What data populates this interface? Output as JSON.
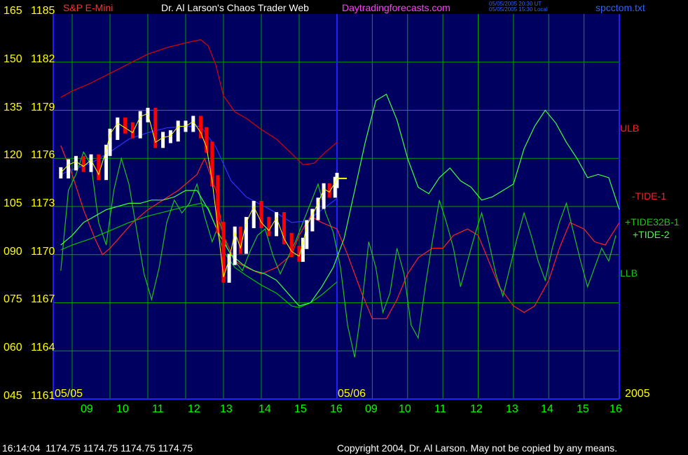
{
  "header": {
    "symbol": "S&P E-Mini",
    "title": "Dr. Al Larson's Chaos Trader Web",
    "site": "Daytradingforecasts.com",
    "time_ut": "05/05/2005 20:30 UT",
    "time_local": "05/05/2005 15:30 Local",
    "file": "spcctom.txt"
  },
  "footer": {
    "clock": "16:14:04",
    "ohlc": "1174.75 1174.75 1174.75 1174.75",
    "copyright": "Copyright 2004, Dr. Al Larson. May not be copied by any means."
  },
  "colors": {
    "background": "#000060",
    "grid": "#00a000",
    "axis": "#2020ff",
    "left_labels": "#ffff00",
    "time_labels": "#00ff00",
    "price_up": "#ffffff",
    "price_down": "#ff0000",
    "ulb": "#e00000",
    "llb": "#00c000",
    "tide_1": "#ff2020",
    "tide32b": "#20c020",
    "tide_2": "#40ff40",
    "blue_avg": "#3030ff",
    "yellow_avg": "#ffff00"
  },
  "chart_data": {
    "type": "line",
    "title": "S&P E-Mini",
    "y_left_osc": [
      "165",
      "150",
      "135",
      "120",
      "105",
      "090",
      "075",
      "060",
      "045"
    ],
    "y_left_price": [
      "1185",
      "1182",
      "1179",
      "1176",
      "1173",
      "1170",
      "1167",
      "1164",
      "1161"
    ],
    "ylim_price": [
      1161,
      1185
    ],
    "ylim_osc": [
      45,
      165
    ],
    "date_labels": [
      "05/05",
      "05/06"
    ],
    "year_label": "2005",
    "x_ticks": [
      "09",
      "10",
      "11",
      "12",
      "13",
      "14",
      "15",
      "16",
      "09",
      "10",
      "11",
      "12",
      "13",
      "14",
      "15",
      "16"
    ],
    "grid": true,
    "legend": [
      "ULB",
      "-TIDE-1",
      "+TIDE32B-1",
      "+TIDE-2",
      "LLB"
    ],
    "series": [
      {
        "name": "S&P E-Mini",
        "x": [
          8.7,
          8.9,
          9.1,
          9.3,
          9.5,
          9.7,
          9.9,
          10.0,
          10.2,
          10.4,
          10.6,
          10.8,
          11.0,
          11.2,
          11.4,
          11.6,
          11.8,
          12.0,
          12.2,
          12.4,
          12.55,
          12.7,
          12.85,
          13.0,
          13.15,
          13.3,
          13.45,
          13.6,
          13.8,
          14.0,
          14.2,
          14.4,
          14.6,
          14.8,
          15.0,
          15.1,
          15.2,
          15.35,
          15.5,
          15.65,
          15.8,
          15.95,
          16.0
        ],
        "values": [
          1175.1,
          1175.6,
          1175.8,
          1175.5,
          1175.9,
          1175.0,
          1176.5,
          1177.5,
          1178.2,
          1177.9,
          1177.6,
          1178.6,
          1178.8,
          1177.0,
          1177.3,
          1177.4,
          1178.0,
          1178.0,
          1178.3,
          1177.6,
          1176.7,
          1174.6,
          1171.7,
          1168.6,
          1169.7,
          1171.4,
          1170.4,
          1172.0,
          1173.0,
          1172.0,
          1171.5,
          1172.3,
          1171.0,
          1170.2,
          1169.9,
          1170.7,
          1171.8,
          1172.5,
          1173.2,
          1174.1,
          1173.9,
          1174.5,
          1174.75
        ]
      },
      {
        "name": "ULB",
        "x": [
          8.7,
          9.0,
          9.5,
          10.0,
          10.5,
          11.0,
          11.5,
          12.0,
          12.4,
          12.6,
          12.8,
          13.0,
          13.3,
          13.6,
          14.0,
          14.4,
          14.8,
          15.1,
          15.4,
          15.7,
          16.0
        ],
        "values": [
          1179.8,
          1180.2,
          1180.7,
          1181.3,
          1181.9,
          1182.5,
          1182.9,
          1183.2,
          1183.4,
          1183.0,
          1181.8,
          1179.9,
          1178.9,
          1178.5,
          1177.8,
          1177.2,
          1176.3,
          1175.6,
          1175.7,
          1176.4,
          1177.0
        ]
      },
      {
        "name": "LLB",
        "x": [
          8.7,
          9.0,
          9.5,
          10.0,
          10.5,
          11.0,
          11.5,
          12.0,
          12.4,
          12.6,
          12.8,
          13.0,
          13.3,
          13.6,
          14.0,
          14.4,
          14.8,
          15.0,
          15.3,
          15.6,
          16.0
        ],
        "values": [
          1170.3,
          1170.6,
          1171.0,
          1171.5,
          1172.0,
          1172.4,
          1172.7,
          1173.0,
          1173.2,
          1172.9,
          1171.7,
          1170.2,
          1169.2,
          1168.7,
          1168.1,
          1167.6,
          1166.8,
          1166.7,
          1167.0,
          1167.5,
          1168.3
        ]
      },
      {
        "name": "-TIDE-1",
        "x": [
          8.7,
          9.0,
          9.3,
          9.6,
          9.8,
          10.0,
          10.3,
          10.6,
          11.0,
          11.4,
          11.8,
          12.0,
          12.3,
          12.5,
          12.8,
          13.0,
          13.3,
          13.6,
          14.0,
          14.4,
          14.8,
          15.0,
          15.3,
          15.6,
          16.0,
          16.3,
          16.7,
          17.0,
          17.4,
          17.7,
          18.0,
          18.3,
          18.7,
          19.0,
          19.3,
          19.7,
          20.0,
          20.3,
          20.6,
          21.0,
          21.3,
          21.6,
          22.0,
          22.3,
          22.6,
          23.0,
          23.3,
          23.6,
          24.0
        ],
        "values": [
          124,
          115,
          104,
          95,
          90,
          92,
          96,
          100,
          104,
          107,
          110,
          112,
          115,
          120,
          110,
          96,
          88,
          86,
          84,
          86,
          90,
          96,
          102,
          100,
          98,
          90,
          78,
          70,
          70,
          76,
          84,
          89,
          92,
          92,
          96,
          98,
          96,
          88,
          80,
          74,
          72,
          74,
          82,
          92,
          100,
          98,
          94,
          93,
          100
        ]
      },
      {
        "name": "+TIDE32B-1",
        "x": [
          8.7,
          8.9,
          9.1,
          9.3,
          9.5,
          9.7,
          9.9,
          10.1,
          10.3,
          10.5,
          10.7,
          10.9,
          11.1,
          11.3,
          11.5,
          11.7,
          11.9,
          12.1,
          12.3,
          12.5,
          12.7,
          12.9,
          13.1,
          13.3,
          13.5,
          13.7,
          13.9,
          14.1,
          14.3,
          14.5,
          14.7,
          14.9,
          15.1,
          15.3,
          15.5,
          15.7,
          15.9,
          16.1,
          16.3,
          16.5,
          16.7,
          16.9,
          17.1,
          17.3,
          17.5,
          17.7,
          17.9,
          18.1,
          18.3,
          18.5,
          18.7,
          18.9,
          19.1,
          19.3,
          19.5,
          19.7,
          19.9,
          20.1,
          20.3,
          20.5,
          20.7,
          20.9,
          21.1,
          21.3,
          21.5,
          21.7,
          21.9,
          22.1,
          22.3,
          22.5,
          22.7,
          22.9,
          23.1,
          23.3,
          23.5,
          23.7,
          23.9
        ],
        "values": [
          85,
          110,
          115,
          122,
          118,
          100,
          93,
          110,
          120,
          112,
          98,
          84,
          76,
          86,
          100,
          107,
          103,
          106,
          112,
          102,
          94,
          100,
          92,
          88,
          85,
          91,
          96,
          98,
          90,
          84,
          89,
          94,
          100,
          106,
          112,
          103,
          97,
          86,
          68,
          58,
          74,
          94,
          86,
          72,
          78,
          92,
          84,
          68,
          64,
          80,
          94,
          107,
          100,
          92,
          80,
          88,
          96,
          103,
          94,
          84,
          77,
          86,
          95,
          103,
          96,
          88,
          82,
          92,
          100,
          106,
          97,
          88,
          80,
          86,
          92,
          88,
          96
        ]
      },
      {
        "name": "+TIDE-2",
        "x": [
          8.7,
          9.0,
          9.3,
          9.6,
          9.9,
          10.2,
          10.5,
          10.8,
          11.1,
          11.4,
          11.7,
          12.0,
          12.3,
          12.6,
          12.9,
          13.2,
          13.5,
          13.8,
          14.1,
          14.4,
          14.7,
          15.0,
          15.3,
          15.6,
          15.9,
          16.2,
          16.5,
          16.8,
          17.1,
          17.4,
          17.7,
          18.0,
          18.3,
          18.6,
          18.9,
          19.2,
          19.5,
          19.8,
          20.1,
          20.4,
          20.7,
          21.0,
          21.3,
          21.6,
          21.9,
          22.2,
          22.5,
          22.8,
          23.1,
          23.4,
          23.7,
          24.0
        ],
        "values": [
          93,
          96,
          100,
          102,
          104,
          105,
          106,
          106,
          107,
          107,
          108,
          110,
          110,
          104,
          96,
          90,
          87,
          85,
          84,
          82,
          78,
          74,
          75,
          80,
          86,
          95,
          110,
          125,
          138,
          140,
          132,
          120,
          111,
          109,
          114,
          117,
          113,
          111,
          107,
          108,
          110,
          112,
          123,
          130,
          135,
          131,
          125,
          120,
          114,
          115,
          114,
          104
        ]
      },
      {
        "name": "blue average",
        "x": [
          8.7,
          9.0,
          9.5,
          10.0,
          10.5,
          11.0,
          11.5,
          12.0,
          12.4,
          12.8,
          13.2,
          13.6,
          14.0,
          14.4,
          14.8,
          15.2,
          15.6,
          16.0
        ],
        "values": [
          1175.0,
          1175.3,
          1175.7,
          1176.4,
          1177.2,
          1177.6,
          1177.9,
          1178.0,
          1178.0,
          1176.7,
          1174.6,
          1173.6,
          1173.1,
          1172.6,
          1172.0,
          1172.1,
          1172.8,
          1173.5
        ]
      }
    ]
  }
}
